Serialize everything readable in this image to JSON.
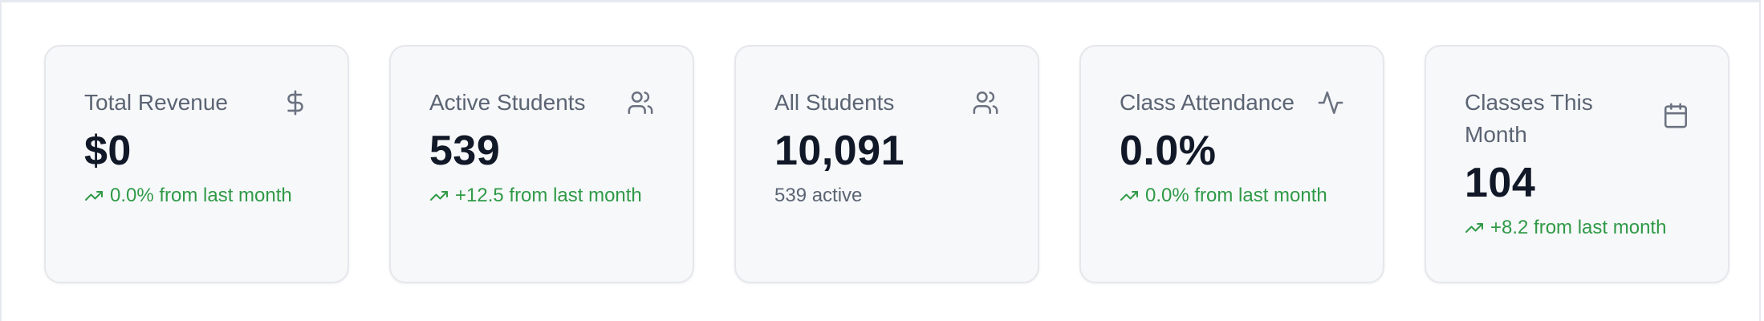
{
  "cards": [
    {
      "title": "Total Revenue",
      "icon": "dollar-icon",
      "value": "$0",
      "sub": "0.0% from last month",
      "sub_trend": true
    },
    {
      "title": "Active Students",
      "icon": "users-icon",
      "value": "539",
      "sub": "+12.5 from last month",
      "sub_trend": true
    },
    {
      "title": "All Students",
      "icon": "users-icon",
      "value": "10,091",
      "sub": "539 active",
      "sub_trend": false
    },
    {
      "title": "Class Attendance",
      "icon": "activity-icon",
      "value": "0.0%",
      "sub": "0.0% from last month",
      "sub_trend": true
    },
    {
      "title": "Classes This Month",
      "icon": "calendar-icon",
      "value": "104",
      "sub": "+8.2 from last month",
      "sub_trend": true
    }
  ],
  "colors": {
    "positive": "#2f9a47",
    "muted": "#5b6473",
    "value": "#111827",
    "card_bg": "#f7f8fa"
  }
}
